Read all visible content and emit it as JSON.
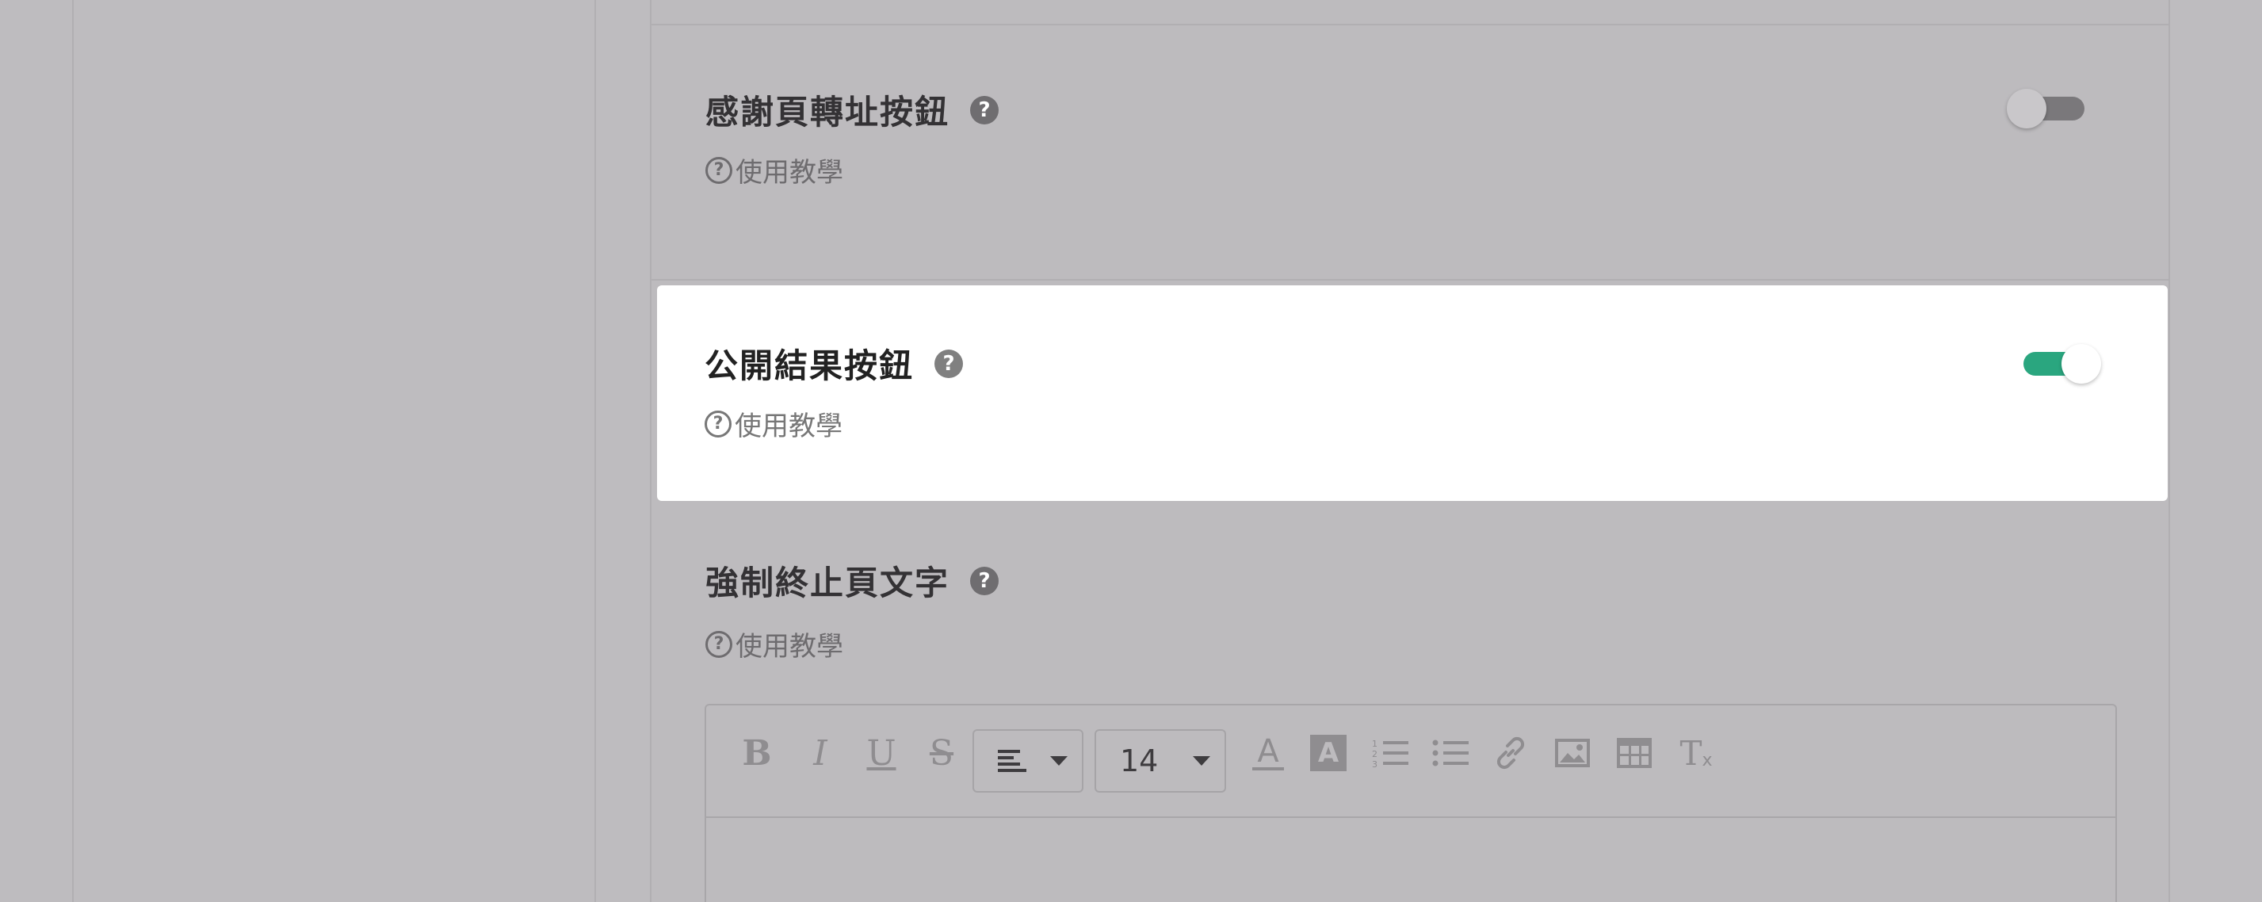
{
  "settings": {
    "thankyou_redirect": {
      "title": "感謝頁轉址按鈕",
      "help": "?",
      "tutorial": "使用教學",
      "enabled": false
    },
    "public_result": {
      "title": "公開結果按鈕",
      "help": "?",
      "tutorial": "使用教學",
      "enabled": true
    },
    "force_stop_text": {
      "title": "強制終止頁文字",
      "help": "?",
      "tutorial": "使用教學"
    }
  },
  "editor": {
    "toolbar": {
      "bold": "B",
      "italic": "I",
      "underline": "U",
      "strike": "S",
      "align_icon": "align-left-icon",
      "font_size": "14",
      "font_color": "A",
      "bg_color": "A",
      "clear_format": "T"
    },
    "icons": [
      "bold-icon",
      "italic-icon",
      "underline-icon",
      "strikethrough-icon",
      "align-left-icon",
      "font-color-icon",
      "background-color-icon",
      "ordered-list-icon",
      "bullet-list-icon",
      "link-icon",
      "image-icon",
      "table-icon",
      "clear-format-icon"
    ]
  },
  "colors": {
    "toggle_on": "#2aa67f",
    "toggle_off": "#7a787b",
    "overlay": "#bebcbf",
    "highlight": "#ffffff"
  }
}
